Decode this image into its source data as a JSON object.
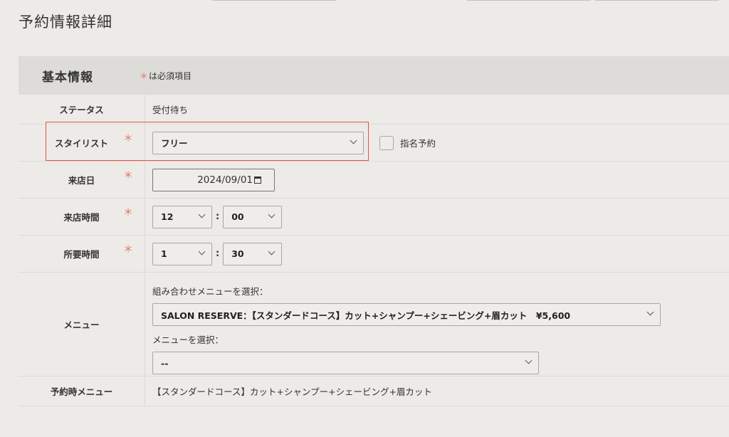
{
  "page": {
    "title": "予約情報詳細"
  },
  "section": {
    "title": "基本情報",
    "required_mark": "＊",
    "required_note": "は必須項目"
  },
  "fields": {
    "status": {
      "label": "ステータス",
      "value": "受付待ち"
    },
    "stylist": {
      "label": "スタイリスト",
      "selected": "フリー",
      "checkbox_label": "指名予約",
      "checkbox_checked": false
    },
    "visit_date": {
      "label": "来店日",
      "value": "2024/09/01"
    },
    "visit_time": {
      "label": "来店時間",
      "hour": "12",
      "minute": "00",
      "separator": ":"
    },
    "duration": {
      "label": "所要時間",
      "hour": "1",
      "minute": "30",
      "separator": ":"
    },
    "menu": {
      "label": "メニュー",
      "combo_caption": "組み合わせメニューを選択：",
      "combo_selected": "SALON RESERVE：【スタンダードコース】カット+シャンプー+シェービング+眉カット　¥5,600",
      "menu_caption": "メニューを選択：",
      "menu_selected": "--"
    },
    "reserved_menu": {
      "label": "予約時メニュー",
      "value": "【スタンダードコース】カット+シャンプー+シェービング+眉カット"
    }
  },
  "colors": {
    "required": "#e0765e",
    "highlight": "#e4543d",
    "background": "#edebe8",
    "panel_header": "#dedcd8"
  }
}
